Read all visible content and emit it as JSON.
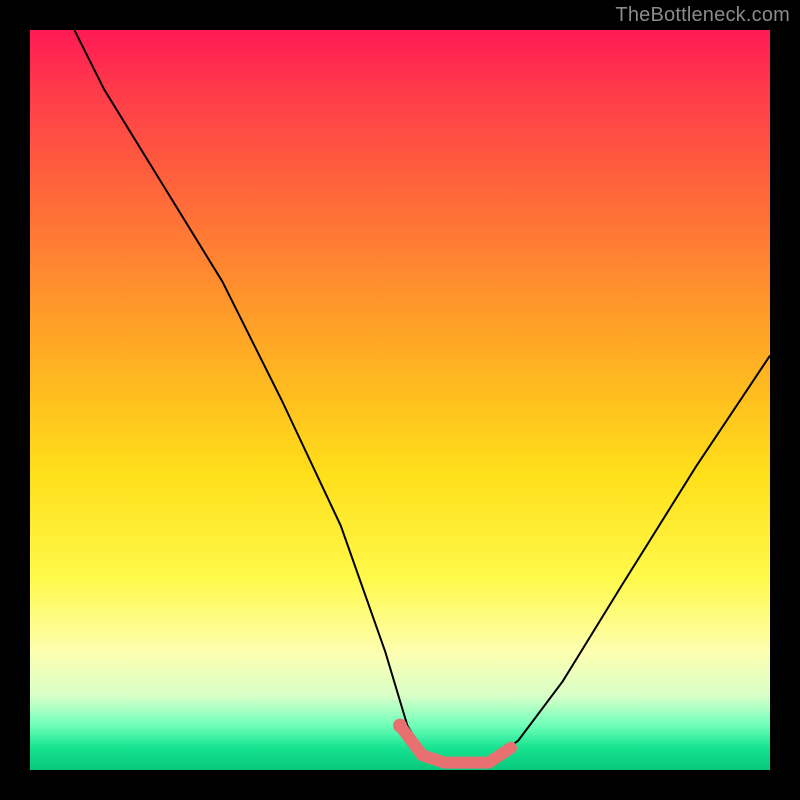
{
  "watermark": {
    "text": "TheBottleneck.com"
  },
  "colors": {
    "frame": "#000000",
    "gradient_stops": [
      "#ff1a55",
      "#ff3a4a",
      "#ff5a3f",
      "#ff7a34",
      "#ff9a2a",
      "#ffba20",
      "#ffdf1a",
      "#fff94a",
      "#fdffb0",
      "#d8ffc8",
      "#6dffba",
      "#16e38f",
      "#08c87d"
    ],
    "curve": "#000000",
    "highlight": "#e97070"
  },
  "chart_data": {
    "type": "line",
    "title": "",
    "xlabel": "",
    "ylabel": "",
    "xlim": [
      0,
      100
    ],
    "ylim": [
      0,
      100
    ],
    "series": [
      {
        "name": "bottleneck-curve",
        "x": [
          6,
          10,
          18,
          26,
          34,
          42,
          48,
          51,
          54,
          58,
          62,
          66,
          72,
          80,
          90,
          100
        ],
        "values": [
          100,
          92,
          79,
          66,
          50,
          33,
          16,
          6,
          1,
          1,
          1,
          4,
          12,
          25,
          41,
          56
        ]
      }
    ],
    "highlight": {
      "name": "optimal-range",
      "x": [
        50,
        53,
        56,
        59,
        62,
        65
      ],
      "values": [
        6,
        2,
        1,
        1,
        1,
        3
      ],
      "dot": {
        "x": 50,
        "y": 6
      }
    }
  }
}
